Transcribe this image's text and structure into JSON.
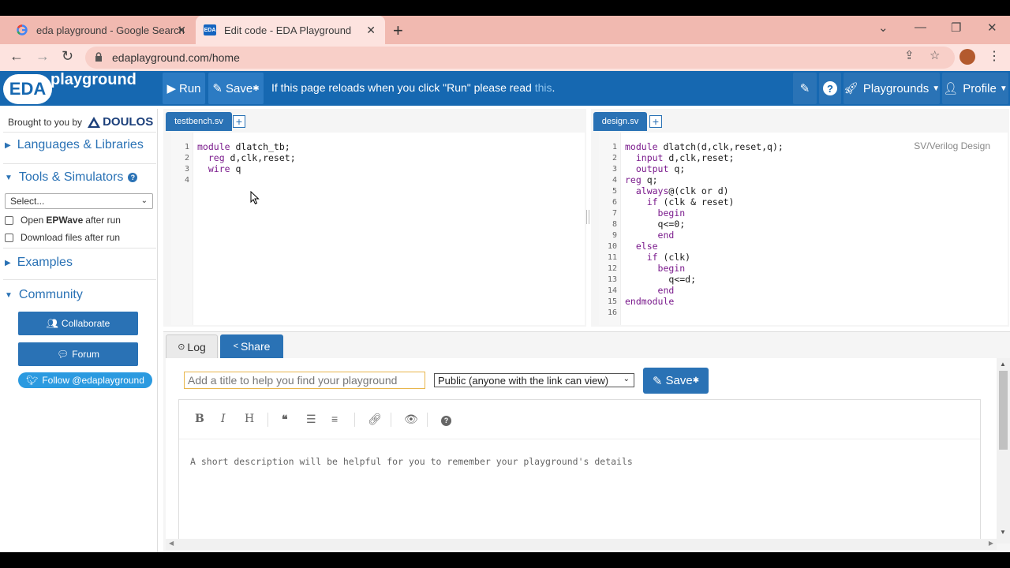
{
  "browser": {
    "tabs": [
      {
        "label": "eda playground - Google Search",
        "favicon": "google-g-icon"
      },
      {
        "label": "Edit code - EDA Playground",
        "favicon": "eda-favicon",
        "favicon_text": "EDA",
        "active": true
      }
    ],
    "url": "edaplayground.com/home"
  },
  "header": {
    "logo_short": "EDA",
    "logo_word": "playground",
    "run_label": "Run",
    "save_label": "Save",
    "message": "If this page reloads when you click \"Run\" please read ",
    "message_link": "this",
    "message_end": ".",
    "playgrounds_label": "Playgrounds",
    "profile_label": "Profile",
    "accent": "#1668b1"
  },
  "sidebar": {
    "brought_by": "Brought to you by",
    "brand": "DOULOS",
    "languages": "Languages & Libraries",
    "tools": "Tools & Simulators",
    "select_value": "Select...",
    "open_epwave_pre": "Open ",
    "open_epwave_bold": "EPWave",
    "open_epwave_post": " after run",
    "download_files": "Download files after run",
    "examples": "Examples",
    "community": "Community",
    "collaborate": "Collaborate",
    "forum": "Forum",
    "twitter": "Follow @edaplayground"
  },
  "editors": {
    "left": {
      "tab": "testbench.sv",
      "lines": [
        "1",
        "2",
        "3",
        "4"
      ],
      "code": [
        {
          "kw": "module",
          "rest": " dlatch_tb;"
        },
        {
          "kw": "  reg",
          "rest": " d,clk,reset;"
        },
        {
          "kw": "  wire",
          "rest": " q"
        },
        {
          "kw": "",
          "rest": ""
        }
      ]
    },
    "right": {
      "tab": "design.sv",
      "hint": "SV/Verilog Design",
      "lines": [
        "1",
        "2",
        "3",
        "4",
        "5",
        "6",
        "7",
        "8",
        "9",
        "10",
        "11",
        "12",
        "13",
        "14",
        "15",
        "16"
      ],
      "code": [
        {
          "kw": "module",
          "rest": " dlatch(d,clk,reset,q);"
        },
        {
          "kw": "  input",
          "rest": " d,clk,reset;"
        },
        {
          "kw": "  output",
          "rest": " q;"
        },
        {
          "kw": "reg",
          "rest": " q;"
        },
        {
          "kw": "  always",
          "rest": "@(clk or d)"
        },
        {
          "kw": "    if",
          "rest": " (clk & reset)"
        },
        {
          "kw": "      begin",
          "rest": ""
        },
        {
          "kw": "",
          "rest": "      q<=0;"
        },
        {
          "kw": "      end",
          "rest": ""
        },
        {
          "kw": "  else",
          "rest": ""
        },
        {
          "kw": "    if",
          "rest": " (clk)"
        },
        {
          "kw": "      begin",
          "rest": ""
        },
        {
          "kw": "",
          "rest": "        q<=d;"
        },
        {
          "kw": "      end",
          "rest": ""
        },
        {
          "kw": "endmodule",
          "rest": ""
        },
        {
          "kw": "",
          "rest": ""
        }
      ]
    }
  },
  "bottom": {
    "log_tab": "Log",
    "share_tab": "Share",
    "title_placeholder": "Add a title to help you find your playground",
    "visibility": "Public (anyone with the link can view)",
    "save_label": "Save",
    "toolbar": [
      "B",
      "I",
      "H"
    ],
    "description_placeholder": "A short description will be helpful for you to remember your playground's details"
  }
}
